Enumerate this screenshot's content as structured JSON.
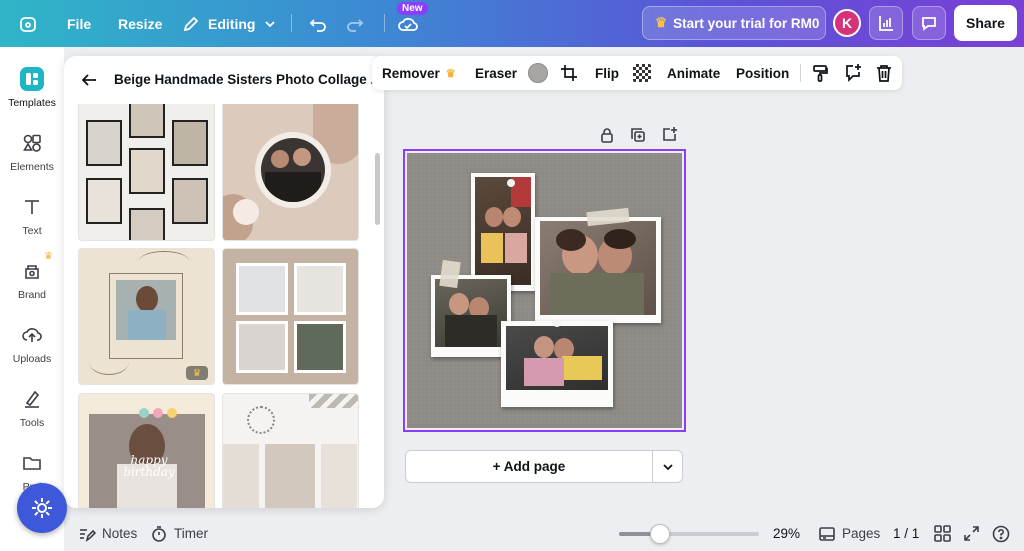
{
  "topbar": {
    "file_label": "File",
    "resize_label": "Resize",
    "editing_label": "Editing",
    "new_badge": "New",
    "trial_label": "Start your trial for RM0",
    "avatar_initial": "K",
    "share_label": "Share"
  },
  "rail": {
    "items": [
      {
        "label": "Templates",
        "icon": "templates-icon"
      },
      {
        "label": "Elements",
        "icon": "elements-icon"
      },
      {
        "label": "Text",
        "icon": "text-icon"
      },
      {
        "label": "Brand",
        "icon": "brand-icon"
      },
      {
        "label": "Uploads",
        "icon": "uploads-icon"
      },
      {
        "label": "Tools",
        "icon": "tools-icon"
      },
      {
        "label": "Proj",
        "icon": "projects-icon"
      }
    ]
  },
  "panel": {
    "title": "Beige Handmade Sisters Photo Collage ...",
    "thumb_text_birthday": "happy birthday"
  },
  "context_toolbar": {
    "remover_label": "Remover",
    "eraser_label": "Eraser",
    "flip_label": "Flip",
    "animate_label": "Animate",
    "position_label": "Position",
    "swatch_color": "#a8a6a3"
  },
  "canvas": {
    "add_page_label": "+ Add page",
    "background_color": "#8e8a86"
  },
  "bottombar": {
    "notes_label": "Notes",
    "timer_label": "Timer",
    "zoom_label": "29%",
    "zoom_fraction": 0.29,
    "pages_label": "Pages",
    "page_count": "1 / 1"
  },
  "colors": {
    "accent": "#8b3dff",
    "magic_button": "#3d58d8"
  }
}
